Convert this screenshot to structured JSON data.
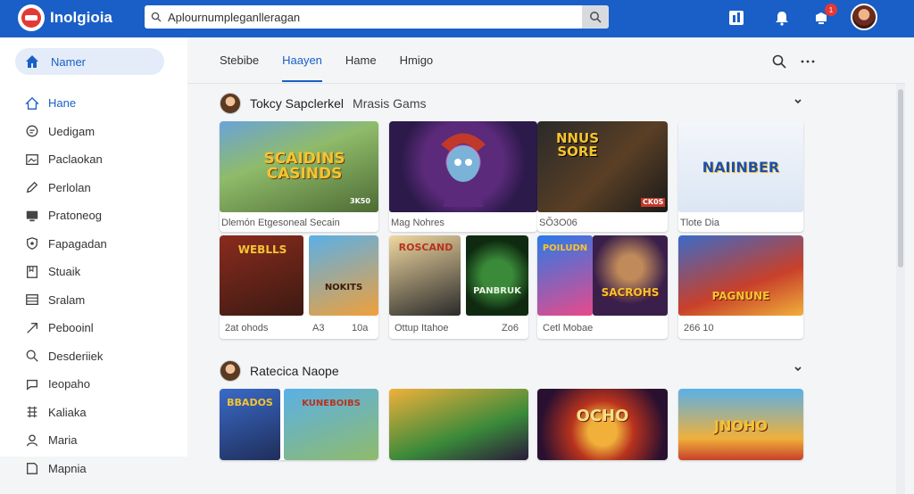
{
  "app": {
    "title": "Inolgioia"
  },
  "search": {
    "value": "Aplournumpleganlleragan",
    "placeholder": ""
  },
  "top_icons": [
    "apps-icon",
    "bell-icon",
    "notification-icon",
    "avatar"
  ],
  "notification_badge": "1",
  "sidebar": {
    "home_pill": "Namer",
    "items": [
      {
        "label": "Hane",
        "icon": "home-icon",
        "active": true
      },
      {
        "label": "Uedigam",
        "icon": "chat-icon"
      },
      {
        "label": "Paclaokan",
        "icon": "image-icon"
      },
      {
        "label": "Perlolan",
        "icon": "edit-icon"
      },
      {
        "label": "Pratoneog",
        "icon": "monitor-icon"
      },
      {
        "label": "Fapagadan",
        "icon": "shield-icon"
      },
      {
        "label": "Stuaik",
        "icon": "bookmark-icon"
      },
      {
        "label": "Sralam",
        "icon": "list-icon"
      },
      {
        "label": "Pebooinl",
        "icon": "send-icon"
      },
      {
        "label": "Desderiiek",
        "icon": "search-icon"
      },
      {
        "label": "Ieopaho",
        "icon": "message-icon"
      },
      {
        "label": "Kaliaka",
        "icon": "grid-icon"
      },
      {
        "label": "Maria",
        "icon": "person-icon"
      },
      {
        "label": "Mapnia",
        "icon": "note-icon"
      }
    ]
  },
  "tabs": [
    "Stebibe",
    "Haayen",
    "Hame",
    "Hmigo"
  ],
  "active_tab": 1,
  "section1": {
    "title": "Tokcy Sapclerkel",
    "subtitle": "Mrasis Gams",
    "cards": [
      {
        "caption": "Dlemón Etgesoneal Secain",
        "art": "SCAIDINS CASINDS",
        "tag": "3K50"
      },
      {
        "caption": "Mag Nohres",
        "art": "",
        "tag": ""
      },
      {
        "caption": "SÕ3O06",
        "art": "NNUS SORE",
        "tag": "CK0S"
      },
      {
        "caption": "Tlote Dia",
        "art": "NAIINBER",
        "tag": ""
      }
    ],
    "cards2": [
      {
        "caption_left": "2at ohods",
        "caption_mid": "A3",
        "caption_right": "10a",
        "art_left": "WEBLLS",
        "art_right": "NOKITS"
      },
      {
        "caption_left": "Ottup Itahoe",
        "caption_right": "Zo6",
        "art_left": "ROSCAND",
        "art_right": "PANBRUK"
      },
      {
        "caption_left": "Cetl Mobae",
        "caption_right": "",
        "art_left": "POILUDN",
        "art_right": "SACROHS"
      },
      {
        "caption_left": "266 10",
        "caption_right": "",
        "art_left": "PAGNUNE",
        "art_right": ""
      }
    ]
  },
  "section2": {
    "title": "Ratecica Naope",
    "art": [
      "BBADOS",
      "KUNEBOIBS",
      "OCHO",
      "JNOHO"
    ]
  },
  "colors": {
    "brand": "#1a5fc7",
    "badge": "#e53935"
  }
}
